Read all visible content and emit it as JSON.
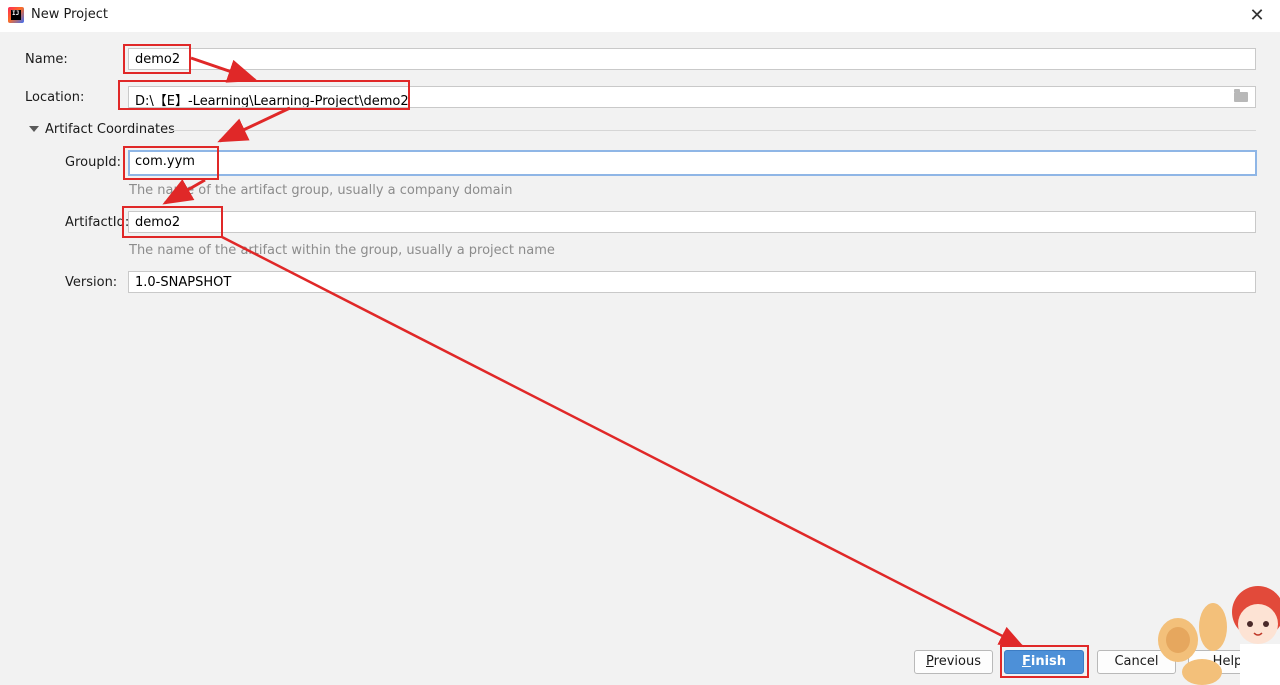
{
  "window": {
    "title": "New Project"
  },
  "form": {
    "name": {
      "label": "Name:",
      "value": "demo2"
    },
    "location": {
      "label": "Location:",
      "value": "D:\\【E】-Learning\\Learning-Project\\demo2"
    },
    "section": {
      "title": "Artifact Coordinates"
    },
    "group_id": {
      "label": "GroupId:",
      "value": "com.yym",
      "hint": "The name of the artifact group, usually a company domain"
    },
    "artifact_id": {
      "label": "ArtifactId:",
      "value": "demo2",
      "hint": "The name of the artifact within the group, usually a project name"
    },
    "version": {
      "label": "Version:",
      "value": "1.0-SNAPSHOT"
    }
  },
  "buttons": {
    "previous": {
      "mnemonic": "P",
      "rest": "revious"
    },
    "finish": {
      "mnemonic": "F",
      "rest": "inish"
    },
    "cancel": "Cancel",
    "help": "Help"
  },
  "icons": {
    "app": "intellij-idea-icon",
    "close": "close-icon",
    "folder": "folder-browse-icon",
    "collapse": "triangle-down-icon"
  },
  "colors": {
    "annotation": "#e02828",
    "primary_button": "#4d90d8",
    "focus_border": "#8fb6e6"
  }
}
